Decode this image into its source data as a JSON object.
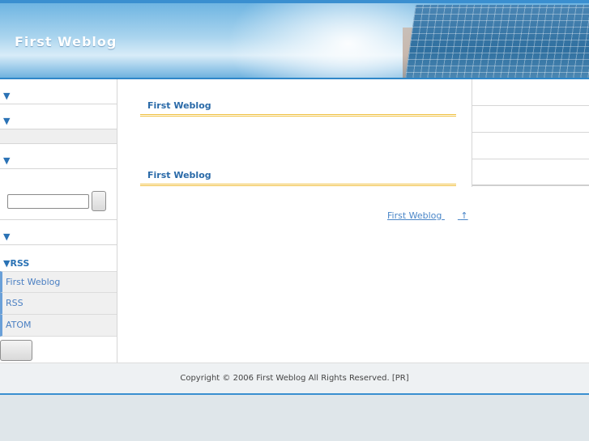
{
  "header": {
    "title": "First Weblog"
  },
  "sidebar": {
    "arrow": "▼",
    "rss_heading": "▼RSS",
    "rss_items": [
      "First Weblog",
      "RSS",
      "ATOM"
    ]
  },
  "main": {
    "entries": [
      {
        "title": "First Weblog"
      },
      {
        "title": "First Weblog"
      }
    ],
    "link": {
      "label": "First Weblog",
      "arrow": "↑"
    }
  },
  "footer": {
    "copyright": "Copyright © 2006 First Weblog All Rights Reserved.  [PR]"
  },
  "colors": {
    "accent": "#3a8fd0",
    "link": "#4a86c8",
    "underline": "#f0c040"
  }
}
